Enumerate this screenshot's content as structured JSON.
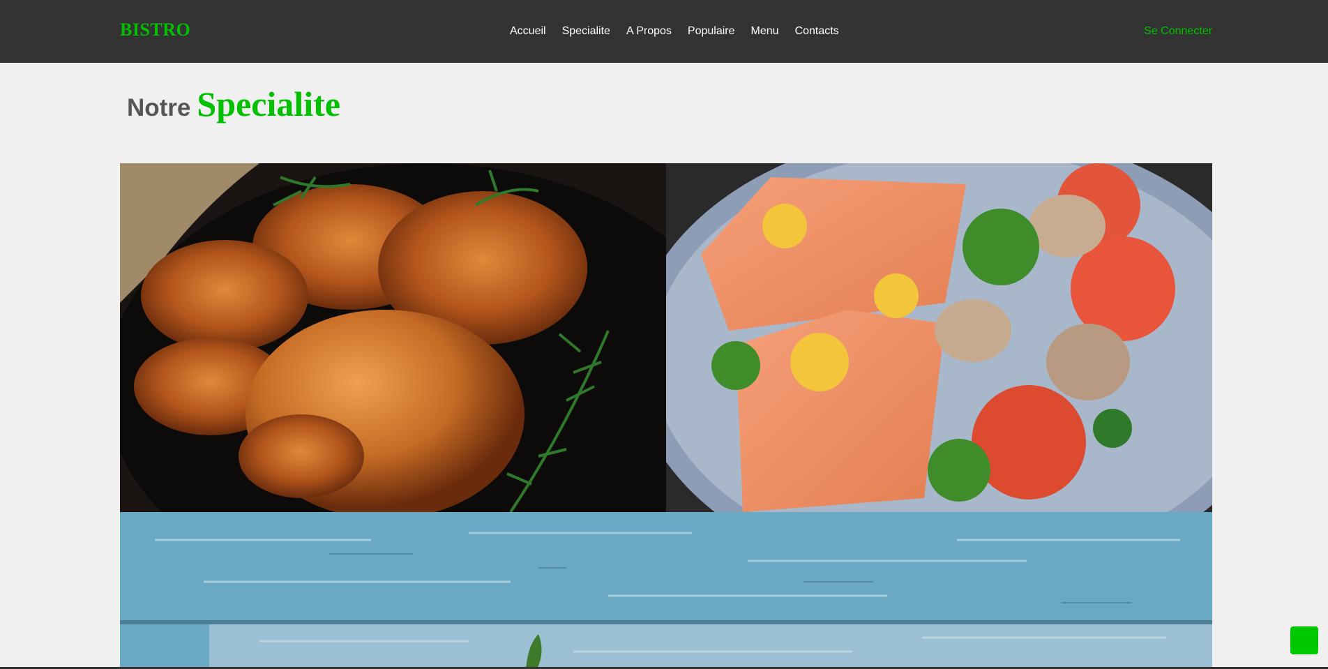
{
  "header": {
    "logo": "BISTRO",
    "nav": [
      "Accueil",
      "Specialite",
      "A Propos",
      "Populaire",
      "Menu",
      "Contacts"
    ],
    "login": "Se Connecter"
  },
  "section": {
    "title_first": "Notre",
    "title_second": "Specialite"
  },
  "colors": {
    "accent": "#00c000",
    "header_bg": "#333333",
    "page_bg": "#f0f0f0"
  },
  "gallery": [
    {
      "name": "glazed-chicken-drumsticks-image"
    },
    {
      "name": "baked-salmon-plate-image"
    },
    {
      "name": "blue-wood-table-image"
    }
  ],
  "floating": {
    "icon": "scroll-top-button"
  }
}
